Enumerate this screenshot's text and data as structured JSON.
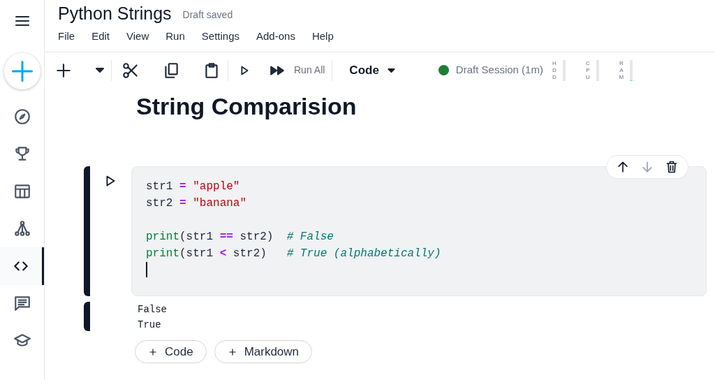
{
  "sidebar": {
    "items": [
      {
        "kind": "compass",
        "selected": false
      },
      {
        "kind": "trophy",
        "selected": false
      },
      {
        "kind": "table",
        "selected": false
      },
      {
        "kind": "graph",
        "selected": false
      },
      {
        "kind": "code",
        "selected": true
      },
      {
        "kind": "chat",
        "selected": false
      },
      {
        "kind": "school",
        "selected": false
      }
    ]
  },
  "header": {
    "title": "Python Strings",
    "save_status": "Draft saved"
  },
  "menu": [
    "File",
    "Edit",
    "View",
    "Run",
    "Settings",
    "Add-ons",
    "Help"
  ],
  "toolbar": {
    "run_all": "Run All",
    "cell_type": "Code",
    "session": {
      "label": "Draft Session (1m)",
      "connected": true
    },
    "meters": [
      {
        "label": "HDD",
        "level": 0
      },
      {
        "label": "CPU",
        "level": 0
      },
      {
        "label": "RAM",
        "level": 0.03
      }
    ]
  },
  "heading": "String Comparision",
  "code_cell": {
    "cursor": true,
    "lines": [
      {
        "kind": "code",
        "tokens": [
          {
            "kind": "plain",
            "text": "str1 "
          },
          {
            "kind": "op",
            "text": "="
          },
          {
            "kind": "str",
            "text": " \"apple\""
          }
        ]
      },
      {
        "kind": "code",
        "tokens": [
          {
            "kind": "plain",
            "text": "str2 "
          },
          {
            "kind": "op",
            "text": "="
          },
          {
            "kind": "str",
            "text": " \"banana\""
          }
        ]
      },
      {
        "kind": "blank"
      },
      {
        "kind": "code",
        "tokens": [
          {
            "kind": "fn",
            "text": "print"
          },
          {
            "kind": "plain",
            "text": "(str1 "
          },
          {
            "kind": "op",
            "text": "=="
          },
          {
            "kind": "plain",
            "text": " str2)  "
          },
          {
            "kind": "comment",
            "text": "# False"
          }
        ]
      },
      {
        "kind": "code",
        "tokens": [
          {
            "kind": "fn",
            "text": "print"
          },
          {
            "kind": "plain",
            "text": "(str1 "
          },
          {
            "kind": "op",
            "text": "<"
          },
          {
            "kind": "plain",
            "text": " str2)   "
          },
          {
            "kind": "comment",
            "text": "# True (alphabetically)"
          }
        ]
      }
    ],
    "output": [
      "False",
      "True"
    ]
  },
  "add_buttons": [
    {
      "label": "Code"
    },
    {
      "label": "Markdown"
    }
  ]
}
